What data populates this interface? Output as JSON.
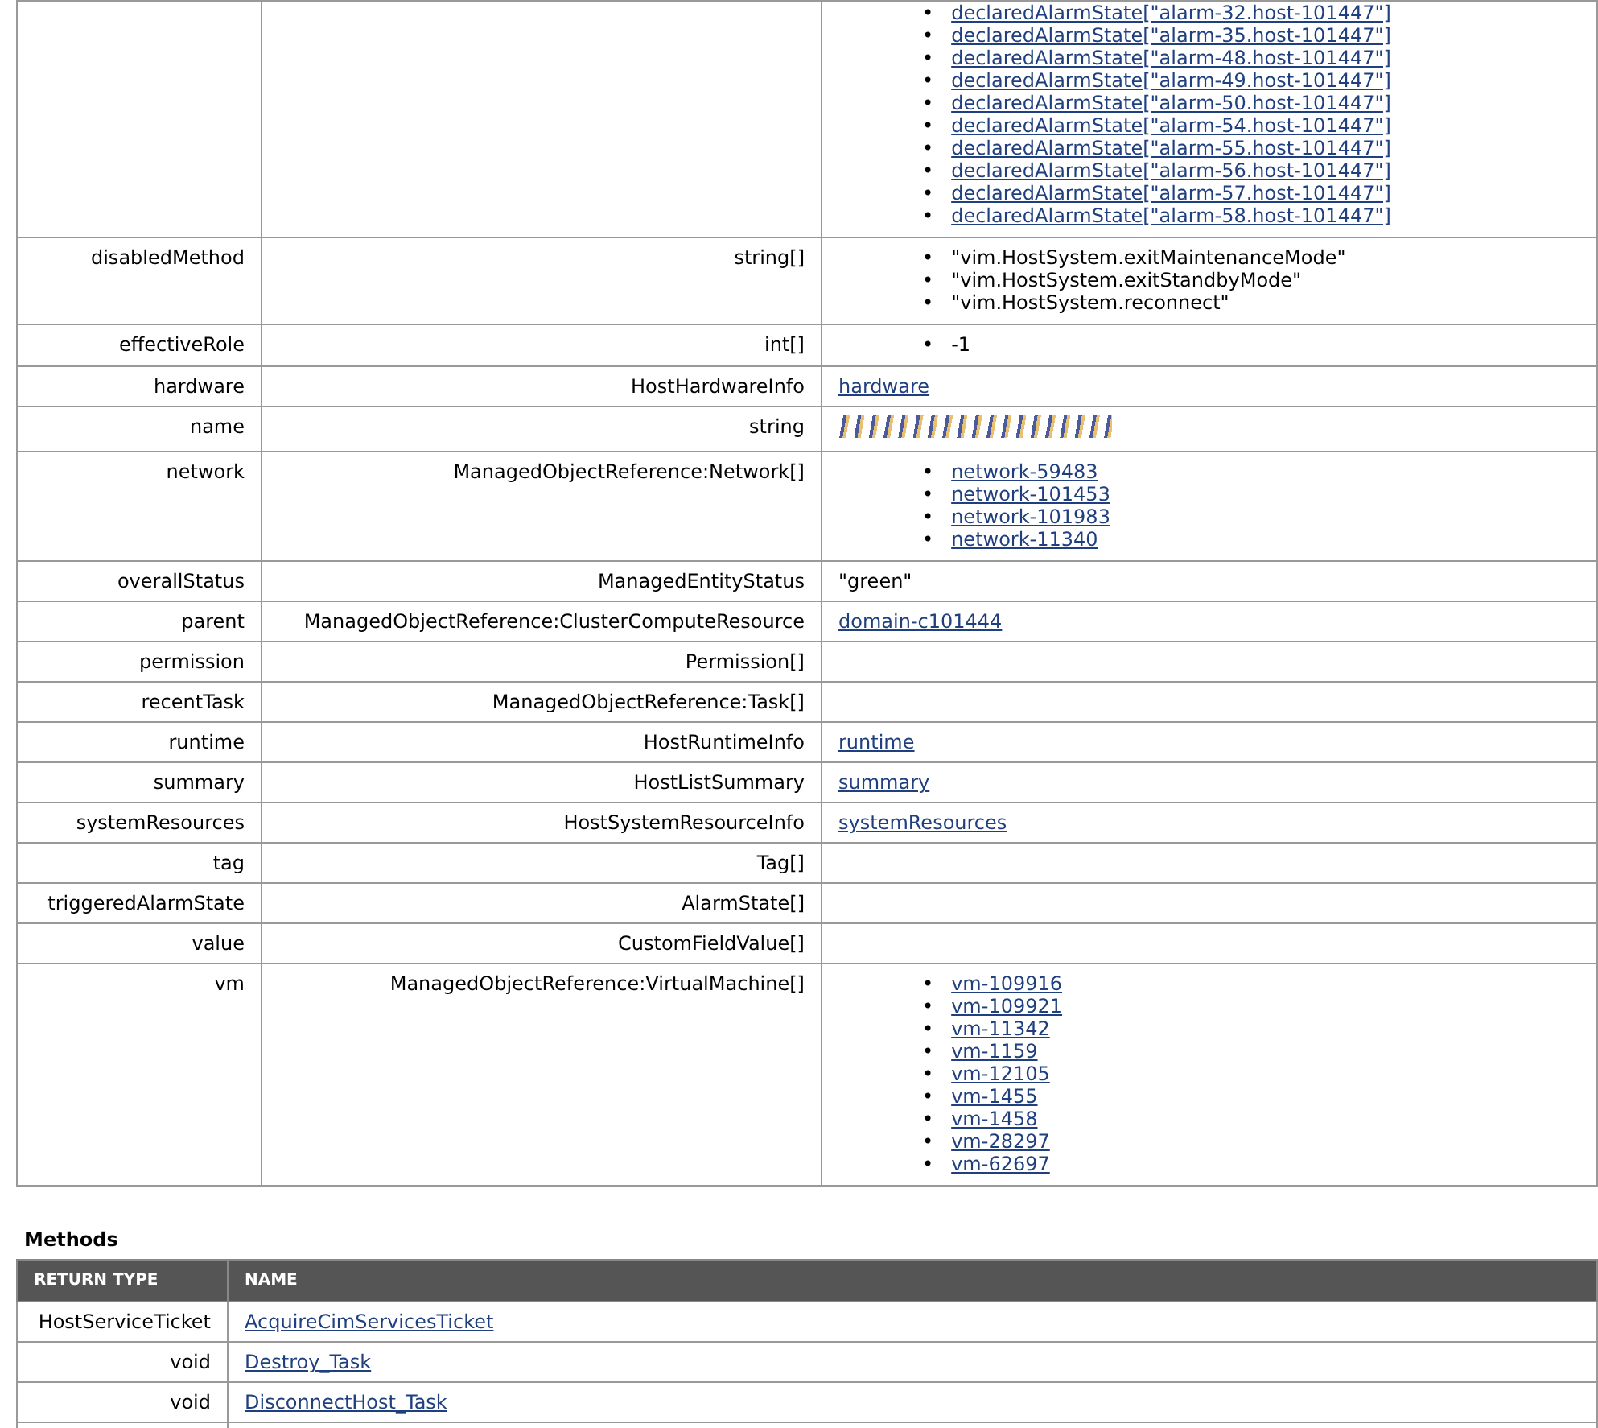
{
  "properties": [
    {
      "kind": "list",
      "bullet": "•",
      "items": [
        {
          "text": "declaredAlarmState[\"alarm-32.host-101447\"]",
          "link": true
        },
        {
          "text": "declaredAlarmState[\"alarm-35.host-101447\"]",
          "link": true
        },
        {
          "text": "declaredAlarmState[\"alarm-48.host-101447\"]",
          "link": true
        },
        {
          "text": "declaredAlarmState[\"alarm-49.host-101447\"]",
          "link": true
        },
        {
          "text": "declaredAlarmState[\"alarm-50.host-101447\"]",
          "link": true
        },
        {
          "text": "declaredAlarmState[\"alarm-54.host-101447\"]",
          "link": true
        },
        {
          "text": "declaredAlarmState[\"alarm-55.host-101447\"]",
          "link": true
        },
        {
          "text": "declaredAlarmState[\"alarm-56.host-101447\"]",
          "link": true
        },
        {
          "text": "declaredAlarmState[\"alarm-57.host-101447\"]",
          "link": true
        },
        {
          "text": "declaredAlarmState[\"alarm-58.host-101447\"]",
          "link": true
        }
      ]
    },
    {
      "name": "disabledMethod",
      "type": "string[]",
      "kind": "list",
      "bullet": "•",
      "items": [
        {
          "text": "\"vim.HostSystem.exitMaintenanceMode\"",
          "link": false
        },
        {
          "text": "\"vim.HostSystem.exitStandbyMode\"",
          "link": false
        },
        {
          "text": "\"vim.HostSystem.reconnect\"",
          "link": false
        }
      ]
    },
    {
      "name": "effectiveRole",
      "type": "int[]",
      "kind": "list",
      "bullet": "•",
      "items": [
        {
          "text": "-1",
          "link": false
        }
      ]
    },
    {
      "name": "hardware",
      "type": "HostHardwareInfo",
      "kind": "link",
      "value": "hardware"
    },
    {
      "name": "name",
      "type": "string",
      "kind": "redacted"
    },
    {
      "name": "network",
      "type": "ManagedObjectReference:Network[]",
      "kind": "list",
      "bullet": "•",
      "items": [
        {
          "text": "network-59483",
          "link": true
        },
        {
          "text": "network-101453",
          "link": true
        },
        {
          "text": "network-101983",
          "link": true
        },
        {
          "text": "network-11340",
          "link": true
        }
      ]
    },
    {
      "name": "overallStatus",
      "type": "ManagedEntityStatus",
      "kind": "text",
      "value": "\"green\""
    },
    {
      "name": "parent",
      "type": "ManagedObjectReference:ClusterComputeResource",
      "kind": "link",
      "value": "domain-c101444"
    },
    {
      "name": "permission",
      "type": "Permission[]",
      "kind": "empty"
    },
    {
      "name": "recentTask",
      "type": "ManagedObjectReference:Task[]",
      "kind": "empty"
    },
    {
      "name": "runtime",
      "type": "HostRuntimeInfo",
      "kind": "link",
      "value": "runtime"
    },
    {
      "name": "summary",
      "type": "HostListSummary",
      "kind": "link",
      "value": "summary"
    },
    {
      "name": "systemResources",
      "type": "HostSystemResourceInfo",
      "kind": "link",
      "value": "systemResources"
    },
    {
      "name": "tag",
      "type": "Tag[]",
      "kind": "empty"
    },
    {
      "name": "triggeredAlarmState",
      "type": "AlarmState[]",
      "kind": "empty"
    },
    {
      "name": "value",
      "type": "CustomFieldValue[]",
      "kind": "empty"
    },
    {
      "name": "vm",
      "type": "ManagedObjectReference:VirtualMachine[]",
      "kind": "list",
      "bullet": "•",
      "items": [
        {
          "text": "vm-109916",
          "link": true
        },
        {
          "text": "vm-109921",
          "link": true
        },
        {
          "text": "vm-11342",
          "link": true
        },
        {
          "text": "vm-1159",
          "link": true
        },
        {
          "text": "vm-12105",
          "link": true
        },
        {
          "text": "vm-1455",
          "link": true
        },
        {
          "text": "vm-1458",
          "link": true
        },
        {
          "text": "vm-28297",
          "link": true
        },
        {
          "text": "vm-62697",
          "link": true
        }
      ]
    }
  ],
  "methods": {
    "title": "Methods",
    "columns": [
      "RETURN TYPE",
      "NAME"
    ],
    "rows": [
      {
        "return_type": "HostServiceTicket",
        "name": "AcquireCimServicesTicket"
      },
      {
        "return_type": "void",
        "name": "Destroy_Task"
      },
      {
        "return_type": "void",
        "name": "DisconnectHost_Task"
      }
    ]
  }
}
